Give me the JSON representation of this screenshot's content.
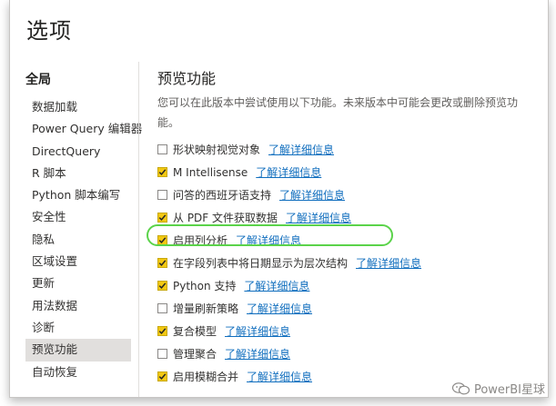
{
  "dialog": {
    "title": "选项"
  },
  "sidebar": {
    "header": "全局",
    "items": [
      {
        "label": "数据加载"
      },
      {
        "label": "Power Query 编辑器"
      },
      {
        "label": "DirectQuery"
      },
      {
        "label": "R 脚本"
      },
      {
        "label": "Python 脚本编写"
      },
      {
        "label": "安全性"
      },
      {
        "label": "隐私"
      },
      {
        "label": "区域设置"
      },
      {
        "label": "更新"
      },
      {
        "label": "用法数据"
      },
      {
        "label": "诊断"
      },
      {
        "label": "预览功能",
        "selected": true
      },
      {
        "label": "自动恢复"
      }
    ]
  },
  "content": {
    "title": "预览功能",
    "description": "您可以在此版本中尝试使用以下功能。未来版本中可能会更改或删除预览功能。",
    "learn_more": "了解详细信息",
    "features": [
      {
        "label": "形状映射视觉对象",
        "checked": false
      },
      {
        "label": "M Intellisense",
        "checked": true
      },
      {
        "label": "问答的西班牙语支持",
        "checked": false
      },
      {
        "label": "从 PDF 文件获取数据",
        "checked": true
      },
      {
        "label": "启用列分析",
        "checked": true,
        "highlighted": true
      },
      {
        "label": "在字段列表中将日期显示为层次结构",
        "checked": true
      },
      {
        "label": "Python 支持",
        "checked": true
      },
      {
        "label": "增量刷新策略",
        "checked": false
      },
      {
        "label": "复合模型",
        "checked": true
      },
      {
        "label": "管理聚合",
        "checked": false
      },
      {
        "label": "启用模糊合并",
        "checked": true
      }
    ]
  },
  "colors": {
    "checkbox_checked": "#f2c811",
    "link": "#106ebe",
    "highlight_ring": "#5bd34a",
    "selected_bg": "#e1dfdd"
  },
  "watermark": {
    "text": "PowerBI星球",
    "icon": "wechat-icon"
  }
}
